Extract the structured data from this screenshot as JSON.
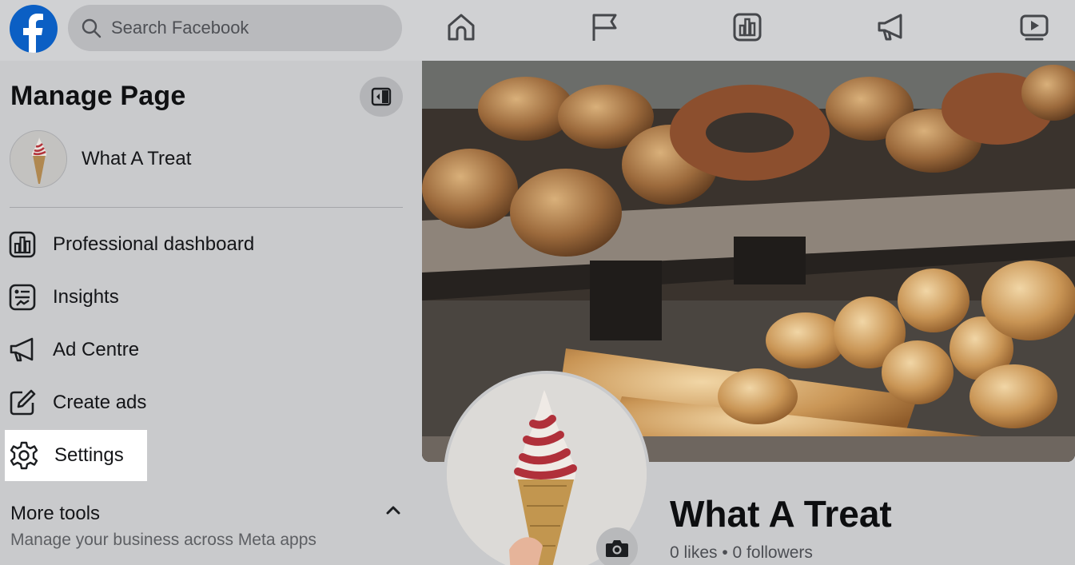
{
  "topbar": {
    "search_placeholder": "Search Facebook",
    "nav_icons": [
      "home-icon",
      "flag-icon",
      "dashboard-icon",
      "megaphone-icon",
      "video-icon"
    ]
  },
  "sidebar": {
    "title": "Manage Page",
    "page_name": "What A Treat",
    "items": [
      {
        "label": "Professional dashboard",
        "icon": "dashboard-icon"
      },
      {
        "label": "Insights",
        "icon": "insights-icon"
      },
      {
        "label": "Ad Centre",
        "icon": "megaphone-icon"
      },
      {
        "label": "Create ads",
        "icon": "edit-icon"
      },
      {
        "label": "Settings",
        "icon": "gear-icon"
      }
    ],
    "more_tools": {
      "title": "More tools",
      "subtitle": "Manage your business across Meta apps"
    }
  },
  "page": {
    "name": "What A Treat",
    "stats": "0 likes • 0 followers"
  },
  "colors": {
    "brand": "#0866ff",
    "overlay_background": "#c9cacc",
    "highlight": "#ffffff"
  }
}
